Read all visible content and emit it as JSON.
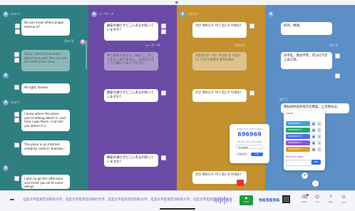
{
  "colors": {
    "teal": "#2f7f80",
    "purple": "#6b4aa5",
    "gold": "#c3912f",
    "blue": "#5c8fc6",
    "accent": "#3b5fd8",
    "record": "#1f9a3b",
    "stop": "#e3342f"
  },
  "col1": {
    "avatar_a": "A",
    "avatar_b": "B",
    "m1_user": "User A",
    "m1": "Do you know where Jingan Avenue is?",
    "m2_user": "User B",
    "m2": "Sorry I don't know much about here well. You can ask the staff of the store.",
    "m3": "All right, thanks.",
    "m4_user": "User C",
    "m4": "I know where the place you're talking about is. Last time I was there. I can tell you where it is.",
    "m5": "The place is an internet celebrity clock-in Youtube~",
    "m6": "I plan to go this afternoon and invite you all to come along!"
  },
  "col2": {
    "avatar": "A",
    "user": "ユーザー A",
    "user_b": "ユーザー B",
    "m1": "静安大通りがどこにあるか知っていますか？",
    "m2": "申し訳ありません、私はここのことをよく知りません。お店のスタッフに聞いてみてください。",
    "m3": "静安大通りがどこにあるか知っていますか？",
    "m4": "静安大通りがどこにあるか知っていますか？"
  },
  "col3": {
    "avatar": "A",
    "user": "사용자 A",
    "user_b": "사용자 B",
    "m1": "진안 애비뉴가 어디 있는지 아세요?",
    "m2": "죄송합니다. 저는 이곳을 잘 모릅니다. 가게 직원에게 물어보세요.",
    "m3": "진안 애비뉴가 어디 있는지 아세요?",
    "m4": "진안 애비뉴가 어디 있는지 아세요?"
  },
  "col4": {
    "avatar": "A",
    "user": "用户 A",
    "user_b": "用户 B",
    "user_c": "用户 C",
    "m1": "好的，谢谢。",
    "m2": "对不起，我也不熟，可以问下店上员工哈。",
    "m3": "我知道你说的地方在哪里，上次我去过。"
  },
  "modal": {
    "code_label": "Enter your room code",
    "code": "696969",
    "lang_label": "Select your language",
    "lang_value": "English",
    "cancel": "Cancel",
    "ok": "OK"
  },
  "panel": {
    "title": "Users",
    "users": [
      "Username 1",
      "Username 2",
      "Username 3",
      "Username 4",
      "Username 5"
    ],
    "input_label": "Write the Room",
    "send": "Join"
  },
  "bottom": {
    "ticker": "这是文字是语音识别的文字。这是文字是语音识别的文字。这是文字是语音识别的文字。这是文字是语音识别的文字。这是文字是语音识别的文字",
    "start_label": "Start",
    "code": "969696",
    "btn_clear": "Clear",
    "btn_user": "User",
    "btn_help": "Help",
    "btn_quit": "Quit"
  }
}
